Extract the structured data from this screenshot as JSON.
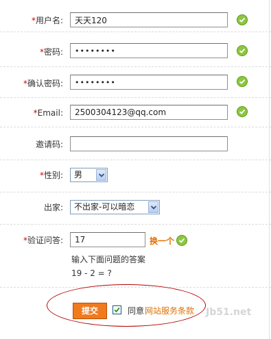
{
  "form": {
    "required_mark": "*",
    "username": {
      "label": "用户名:",
      "value": "天天120"
    },
    "password": {
      "label": "密码:",
      "value": "••••••••"
    },
    "confirm_password": {
      "label": "确认密码:",
      "value": "••••••••"
    },
    "email": {
      "label": "Email:",
      "value": "2500304123@qq.com"
    },
    "invite_code": {
      "label": "邀请码:",
      "value": ""
    },
    "gender": {
      "label": "性别:",
      "selected": "男"
    },
    "ordained": {
      "label": "出家:",
      "selected": "不出家-可以暗恋"
    },
    "captcha": {
      "label": "验证问答:",
      "value": "17",
      "refresh_link": "换一个",
      "hint": "输入下面问题的答案",
      "question": "19 - 2 = ?"
    },
    "submit_label": "提交",
    "agree_text": "同意",
    "terms_link": "网站服务条款",
    "watermark": "Jb51.net"
  },
  "colors": {
    "required": "#d40000",
    "ok_icon": "#8dc63f",
    "submit_bg": "#f07a1e",
    "link": "#e07000",
    "annotation_oval": "#b40000"
  },
  "icons": {
    "valid": "check-circle-icon",
    "dropdown": "chevron-down-icon",
    "checkbox": "checkmark-icon"
  }
}
